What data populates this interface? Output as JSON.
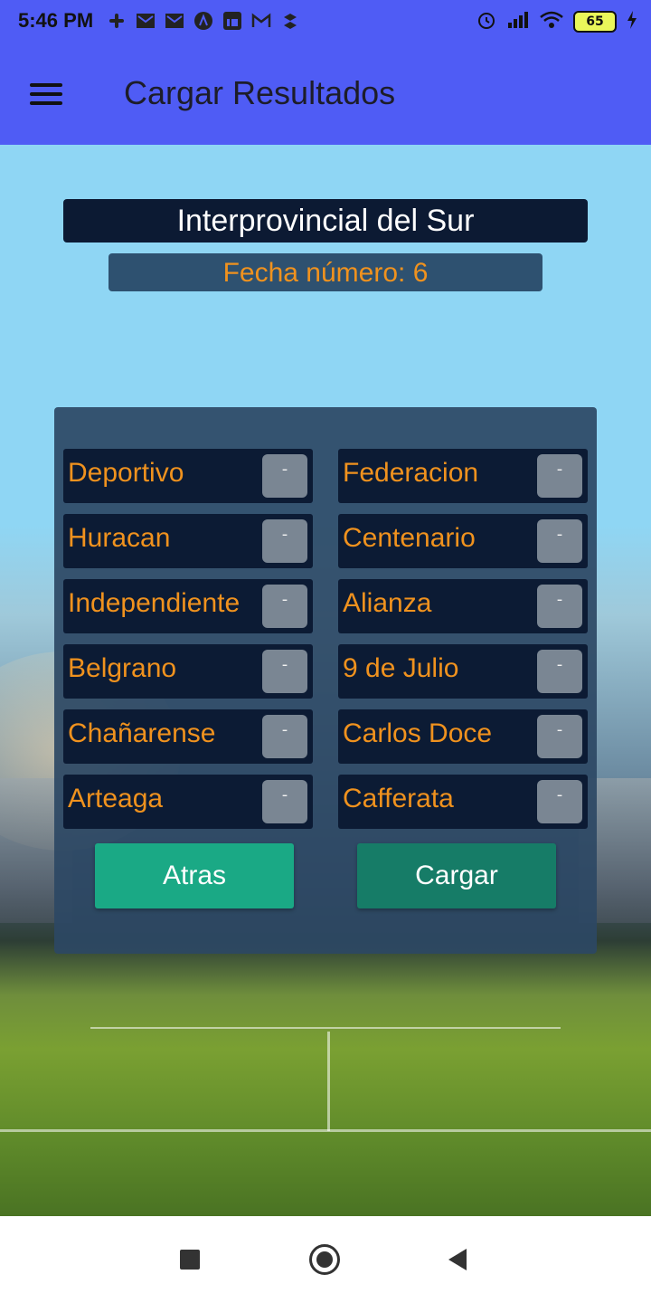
{
  "status_bar": {
    "time": "5:46 PM",
    "notification_icons": [
      "slack-icon",
      "mail-icon",
      "mail-icon",
      "app-icon",
      "linkedin-icon",
      "gmail-icon",
      "dropbox-icon"
    ],
    "battery_level": "65"
  },
  "app_bar": {
    "title": "Cargar Resultados",
    "menu_icon": "hamburger-icon"
  },
  "tournament": {
    "name": "Interprovincial del Sur",
    "fecha_label": "Fecha número: 6"
  },
  "matches": [
    {
      "home": "Deportivo",
      "home_score": "-",
      "away": "Federacion",
      "away_score": "-"
    },
    {
      "home": "Huracan",
      "home_score": "-",
      "away": "Centenario",
      "away_score": "-"
    },
    {
      "home": "Independiente",
      "home_score": "-",
      "away": "Alianza",
      "away_score": "-"
    },
    {
      "home": "Belgrano",
      "home_score": "-",
      "away": "9 de Julio",
      "away_score": "-"
    },
    {
      "home": "Chañarense",
      "home_score": "-",
      "away": "Carlos Doce",
      "away_score": "-"
    },
    {
      "home": "Arteaga",
      "home_score": "-",
      "away": "Cafferata",
      "away_score": "-"
    }
  ],
  "buttons": {
    "back_label": "Atras",
    "load_label": "Cargar"
  },
  "colors": {
    "app_bar": "#4f5cf5",
    "team_text": "#f0921e",
    "back_button": "#1aa985",
    "load_button": "#167c67"
  }
}
